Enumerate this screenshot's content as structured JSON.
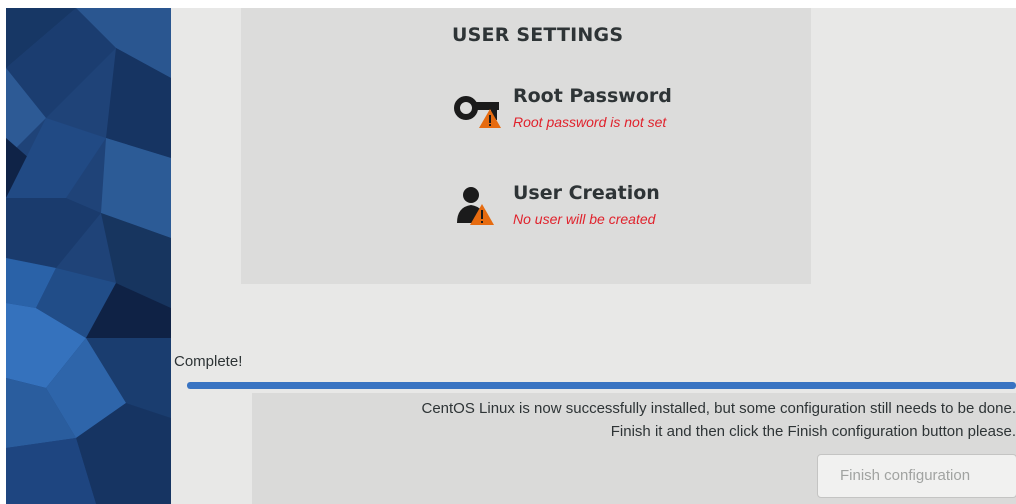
{
  "user_settings": {
    "section_title": "USER SETTINGS",
    "spokes": [
      {
        "title": "Root Password",
        "status": "Root password is not set",
        "icon": "key-warning-icon"
      },
      {
        "title": "User Creation",
        "status": "No user will be created",
        "icon": "user-warning-icon"
      }
    ]
  },
  "progress": {
    "label": "Complete!",
    "fraction": 1.0
  },
  "info": {
    "line1": "CentOS Linux is now successfully installed, but some configuration still needs to be done.",
    "line2": "Finish it and then click the Finish configuration button please."
  },
  "finish_button": {
    "label": "Finish configuration",
    "enabled": false
  },
  "colors": {
    "warning": "#e0222c",
    "accent": "#3873c2",
    "sidebar": "#1d3e73"
  }
}
